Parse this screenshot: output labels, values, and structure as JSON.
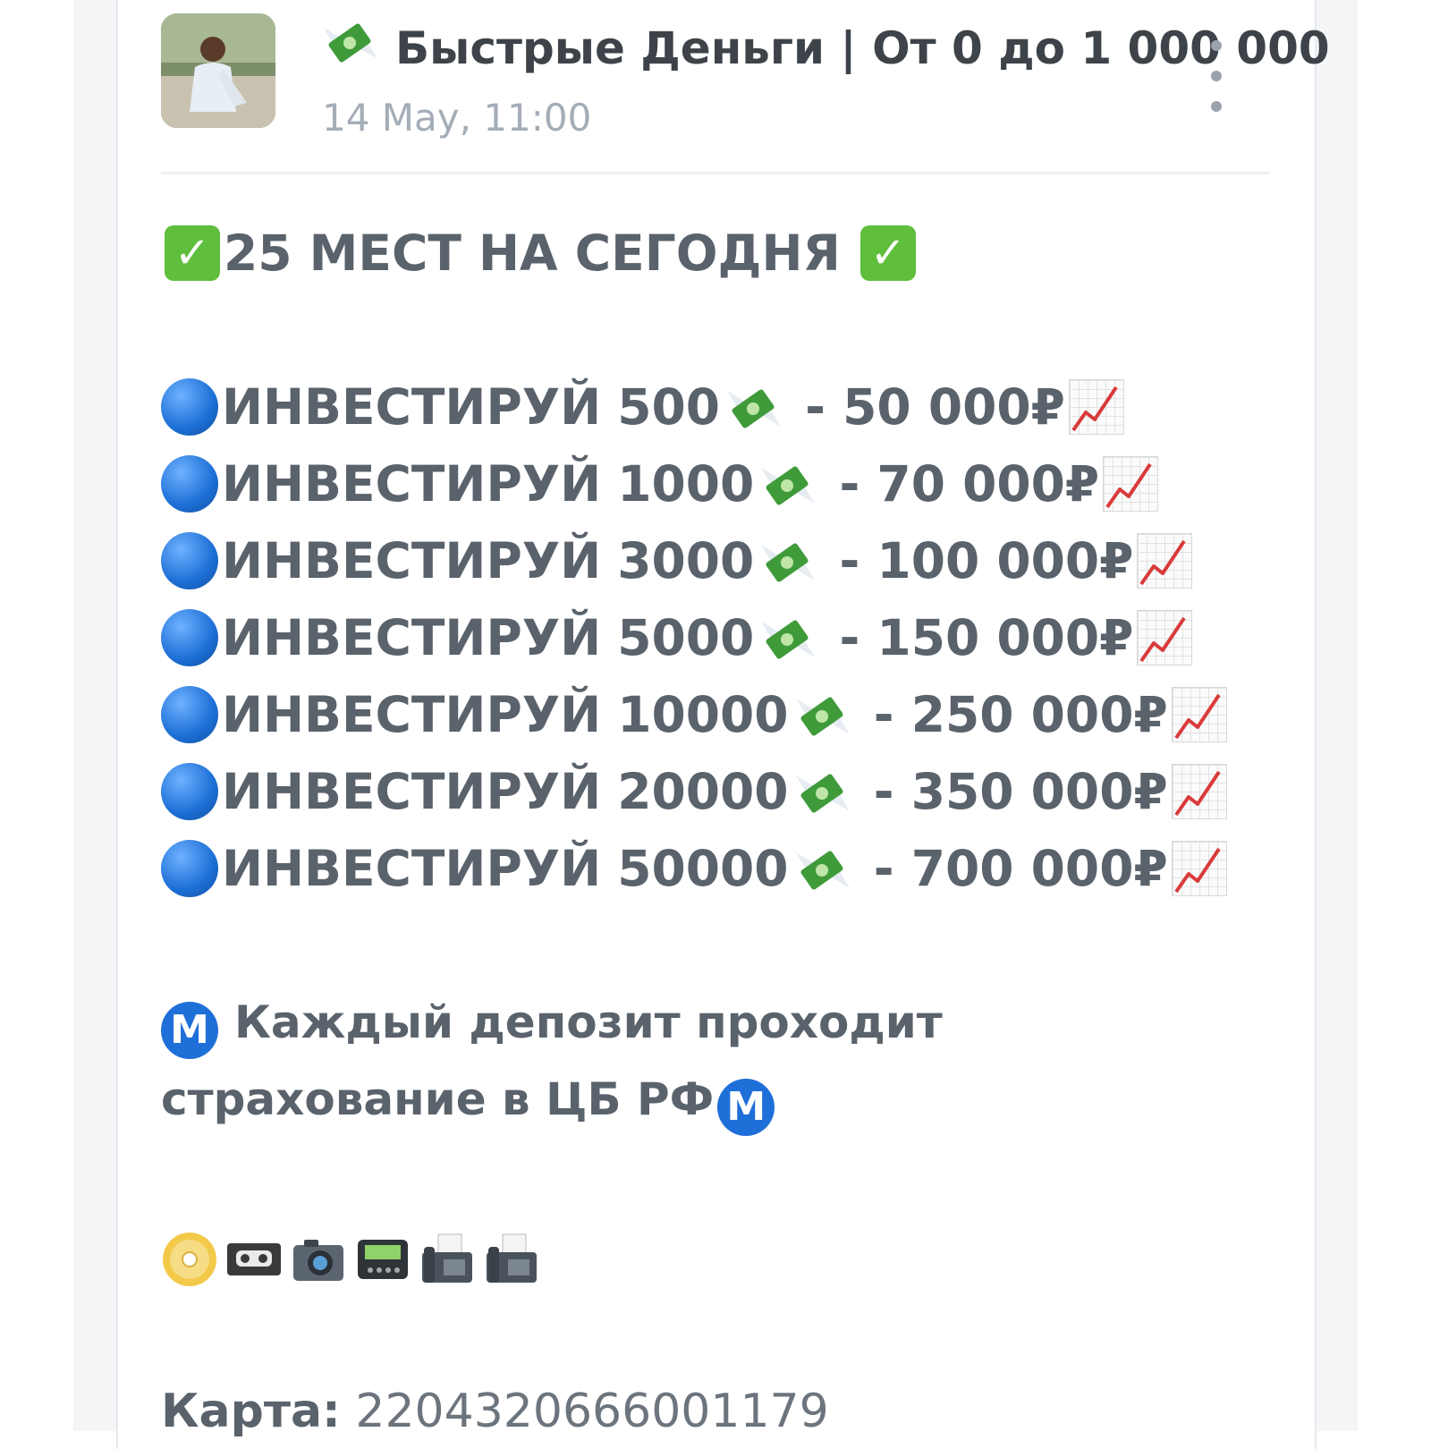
{
  "channel": {
    "emoji": "💸",
    "title": "Быстрые Деньги | От 0 до 1 000 000",
    "date": "14 May, 11:00"
  },
  "post": {
    "headline": "25 МЕСТ НА СЕГОДНЯ",
    "offers": [
      {
        "label": "ИНВЕСТИРУЙ",
        "amount": "500",
        "result": "50 000₽"
      },
      {
        "label": "ИНВЕСТИРУЙ",
        "amount": "1000",
        "result": "70 000₽"
      },
      {
        "label": "ИНВЕСТИРУЙ",
        "amount": "3000",
        "result": "100 000₽"
      },
      {
        "label": "ИНВЕСТИРУЙ",
        "amount": "5000",
        "result": "150 000₽"
      },
      {
        "label": "ИНВЕСТИРУЙ",
        "amount": "10000",
        "result": "250 000₽"
      },
      {
        "label": "ИНВЕСТИРУЙ",
        "amount": "20000",
        "result": "350 000₽"
      },
      {
        "label": "ИНВЕСТИРУЙ",
        "amount": "50000",
        "result": "700 000₽"
      }
    ],
    "separator": " - ",
    "insurance_text": "Каждый депозит проходит страхование в ЦБ РФ",
    "m_symbol": "M",
    "emoji_row": [
      "dvd-icon",
      "videocassette-icon",
      "camera-icon",
      "pager-icon",
      "fax-icon",
      "fax-icon"
    ],
    "card_label": "Карта:",
    "card_number": "2204320666001179"
  },
  "colors": {
    "text": "#5a626b",
    "title": "#3d4349",
    "date": "#a4adb7",
    "check_green": "#5fbe3c",
    "blue": "#1f6fd9"
  }
}
